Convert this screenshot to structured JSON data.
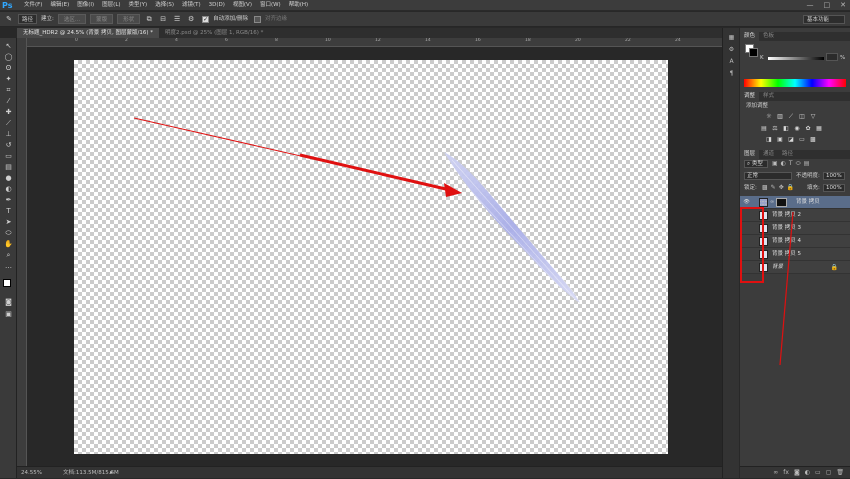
{
  "app": {
    "logo": "Ps"
  },
  "menu": [
    "文件(F)",
    "编辑(E)",
    "图像(I)",
    "图层(L)",
    "类型(Y)",
    "选择(S)",
    "滤镜(T)",
    "3D(D)",
    "视图(V)",
    "窗口(W)",
    "帮助(H)"
  ],
  "window_controls": [
    "—",
    "□",
    "✕"
  ],
  "options": {
    "tool_icon": "brush-icon",
    "mode_value": "路径",
    "build_label": "建立:",
    "selection_btn": "选区...",
    "mask_btn": "蒙版",
    "shape_btn": "形状",
    "auto_add_delete": "自动添加/删除",
    "align_edges": "对齐边缘",
    "auto_add_checked": true,
    "workspace": "基本功能"
  },
  "tabs": [
    {
      "label": "无标题_HDR2 @ 24.5% (背景 拷贝, 图层蒙版/16) *",
      "active": true
    },
    {
      "label": "明度2.psd @ 25% (图层 1, RGB/16) *",
      "active": false
    }
  ],
  "ruler_ticks": [
    "0",
    "2",
    "4",
    "6",
    "8",
    "10",
    "12",
    "14",
    "16",
    "18",
    "20",
    "22",
    "24"
  ],
  "status": {
    "zoom": "24.55%",
    "doc": "文档:113.5M/815.6M"
  },
  "panels": {
    "color_tabs": [
      "颜色",
      "色板"
    ],
    "color_k_label": "K",
    "color_percent": "%",
    "adjust_tabs": [
      "调整",
      "样式"
    ],
    "adjust_title": "添加调整",
    "layers_tabs": [
      "图层",
      "通道",
      "路径"
    ],
    "kind_label": "类型",
    "blend_mode": "正常",
    "opacity_label": "不透明度:",
    "opacity_value": "100%",
    "lock_label": "锁定:",
    "fill_label": "填充:",
    "fill_value": "100%",
    "layers": [
      {
        "name": "背景 拷贝",
        "selected": true,
        "visible": true,
        "has_mask": true
      },
      {
        "name": "背景 拷贝 2",
        "selected": false,
        "visible": false
      },
      {
        "name": "背景 拷贝 3",
        "selected": false,
        "visible": false
      },
      {
        "name": "背景 拷贝 4",
        "selected": false,
        "visible": false
      },
      {
        "name": "背景 拷贝 5",
        "selected": false,
        "visible": false
      },
      {
        "name": "背景",
        "selected": false,
        "visible": false,
        "locked": true
      }
    ],
    "footer_icons": [
      "link-icon",
      "fx-icon",
      "mask-icon",
      "adjustment-icon",
      "group-icon",
      "new-layer-icon",
      "trash-icon"
    ]
  },
  "colors": {
    "annotation": "#e01010",
    "brand": "#31a8ff",
    "selected_layer": "#5a6d8a"
  }
}
